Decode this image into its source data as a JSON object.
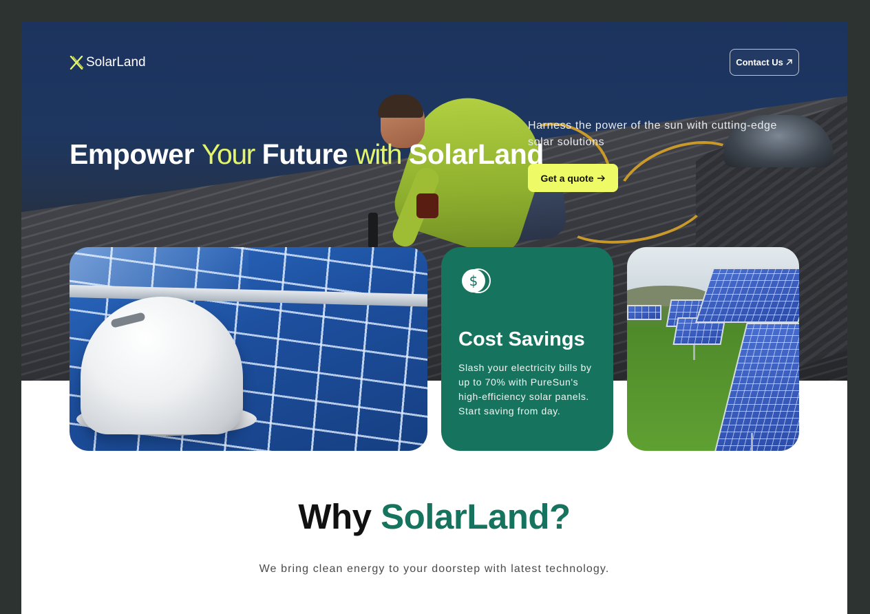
{
  "nav": {
    "brand": "SolarLand",
    "contact_label": "Contact Us"
  },
  "hero": {
    "headline": {
      "part1": "Empower ",
      "part2": "Your",
      "part3": " Future ",
      "part4": "with",
      "part5": " SolarLand"
    },
    "tagline": "Harness the power of the sun with cutting-edge solar solutions",
    "cta_label": "Get a quote"
  },
  "cards": {
    "savings": {
      "title": "Cost Savings",
      "text": "Slash your electricity bills by up to 70% with PureSun's high-efficiency solar panels. Start saving from day."
    }
  },
  "why": {
    "title_part1": "Why ",
    "title_part2": "SolarLand?",
    "subtitle": "We bring clean energy to your doorstep with latest technology."
  },
  "colors": {
    "accent_lime": "#eefb66",
    "brand_green": "#16735e",
    "frame_dark": "#2c3331"
  },
  "icons": [
    "logo-x-icon",
    "arrow-up-right-icon",
    "arrow-right-icon",
    "coin-dollar-icon"
  ]
}
